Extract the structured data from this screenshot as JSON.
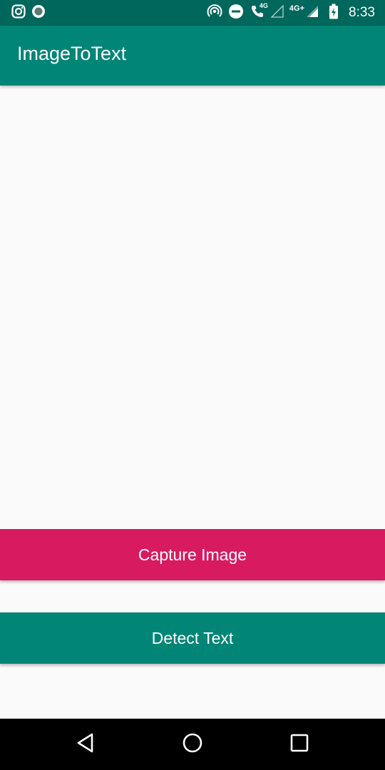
{
  "status_bar": {
    "left_icons": [
      "instagram-icon",
      "circle-notification-icon"
    ],
    "right_icons": [
      "hotspot-icon",
      "do-not-disturb-icon",
      "volte-call-icon",
      "signal-icon",
      "battery-charging-icon"
    ],
    "volte_label": "4G",
    "network_label": "4G+",
    "time": "8:33"
  },
  "app_bar": {
    "title": "ImageToText",
    "color": "#008577",
    "status_color": "#00675c"
  },
  "buttons": {
    "capture_label": "Capture Image",
    "capture_color": "#d81b60",
    "detect_label": "Detect Text",
    "detect_color": "#008577"
  },
  "nav_bar": {
    "icons": [
      "back-icon",
      "home-icon",
      "recents-icon"
    ]
  }
}
